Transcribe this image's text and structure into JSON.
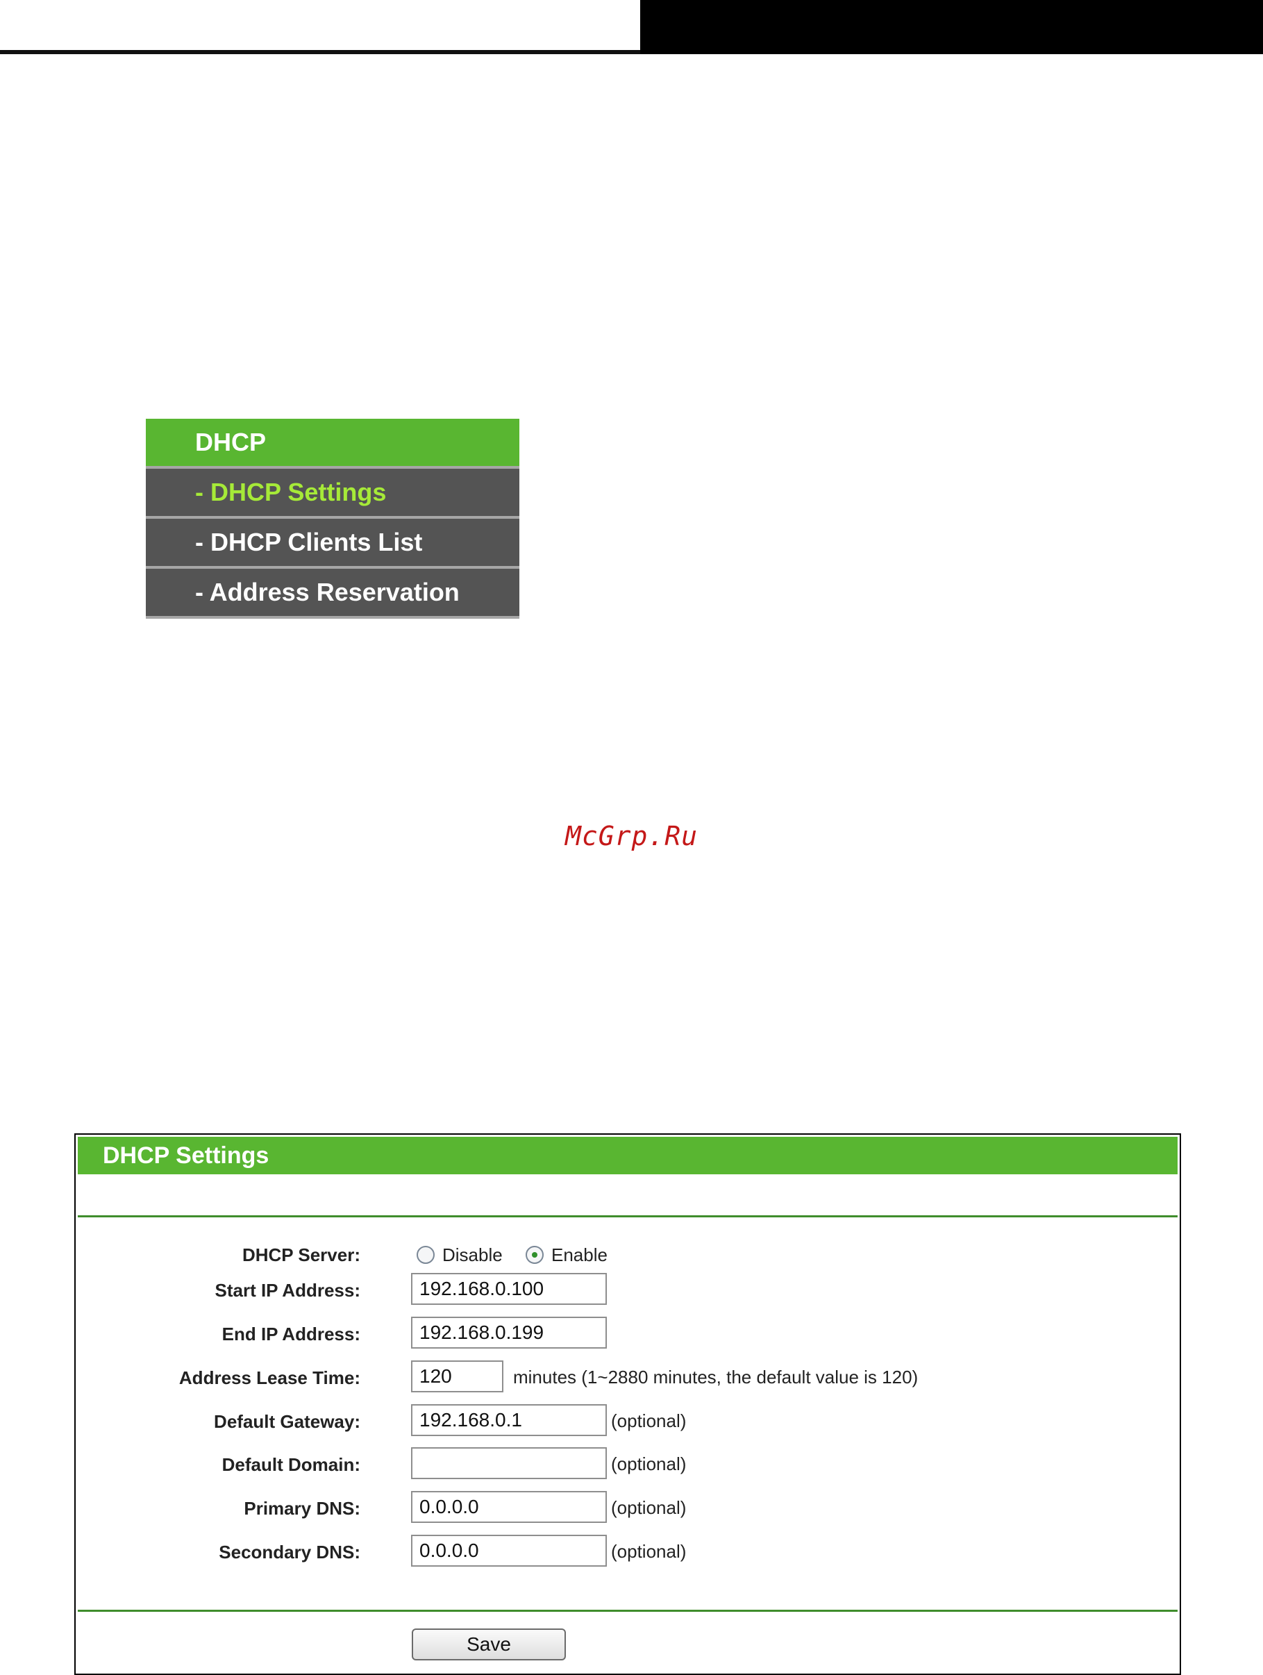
{
  "menu": {
    "heading": "DHCP",
    "items": [
      {
        "label": "- DHCP Settings",
        "active": true
      },
      {
        "label": "- DHCP Clients List",
        "active": false
      },
      {
        "label": "- Address Reservation",
        "active": false
      }
    ]
  },
  "watermark": "McGrp.Ru",
  "settings": {
    "title": "DHCP Settings",
    "dhcp_server": {
      "label": "DHCP Server:",
      "options": [
        "Disable",
        "Enable"
      ],
      "selected": "Enable"
    },
    "start_ip": {
      "label": "Start IP Address:",
      "value": "192.168.0.100"
    },
    "end_ip": {
      "label": "End IP Address:",
      "value": "192.168.0.199"
    },
    "lease_time": {
      "label": "Address Lease Time:",
      "value": "120",
      "note": "minutes (1~2880 minutes, the default value is 120)"
    },
    "gateway": {
      "label": "Default Gateway:",
      "value": "192.168.0.1",
      "note": "(optional)"
    },
    "domain": {
      "label": "Default Domain:",
      "value": "",
      "note": "(optional)"
    },
    "primary_dns": {
      "label": "Primary DNS:",
      "value": "0.0.0.0",
      "note": "(optional)"
    },
    "secondary_dns": {
      "label": "Secondary DNS:",
      "value": "0.0.0.0",
      "note": "(optional)"
    },
    "save_label": "Save"
  },
  "colors": {
    "green": "#59b631",
    "menu_gray": "#545454",
    "active_green": "#a6ea38",
    "watermark_red": "#c41818"
  }
}
